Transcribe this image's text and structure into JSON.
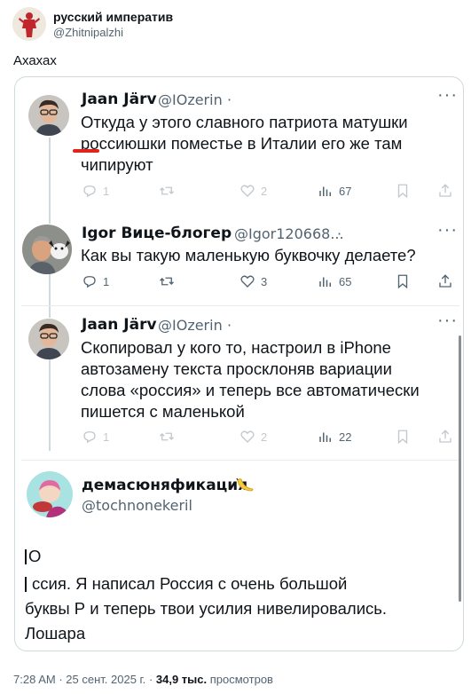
{
  "post": {
    "author_name": "русский императив",
    "author_handle": "@Zhitnipalzhi",
    "text": "Ахахах",
    "time": "7:28 AM",
    "date": "25 сент. 2025 г.",
    "views_count": "34,9 тыс.",
    "views_label": "просмотров"
  },
  "embedded": {
    "tweets": [
      {
        "author_name": "Jaan Järv",
        "author_handle": "@IOzerin",
        "lines": [
          "Откуда у этого славного патриота матушки",
          "россиюшки поместье в Италии его же там",
          "чипируют"
        ],
        "stats": {
          "replies": "1",
          "retweets": "",
          "likes": "2",
          "views": "67"
        }
      },
      {
        "author_name": "Igor Вице-блогер",
        "author_handle": "@Igor120668...",
        "lines": [
          "Как вы такую маленькую буквочку делаете?"
        ],
        "stats": {
          "replies": "1",
          "retweets": "",
          "likes": "3",
          "views": "65"
        }
      },
      {
        "author_name": "Jaan Järv",
        "author_handle": "@IOzerin",
        "lines": [
          "Скопировал у кого то, настроил в iPhone",
          "автозамену текста просклоняв вариации",
          "слова «россия» и теперь все автоматически",
          "пишется с маленькой"
        ],
        "stats": {
          "replies": "1",
          "retweets": "",
          "likes": "2",
          "views": "22"
        }
      }
    ],
    "reply": {
      "author_name": "демасюняфикация",
      "author_handle": "@tochnonekeril",
      "lines": [
        "О",
        "ссия. Я написал Россия с очень большой",
        "буквы Р и теперь твои усилия нивелировались.",
        "Лошара"
      ]
    }
  },
  "colors": {
    "text": "#0f1419",
    "muted": "#536471",
    "border": "#cfd9de",
    "underline": "#e0241b"
  }
}
